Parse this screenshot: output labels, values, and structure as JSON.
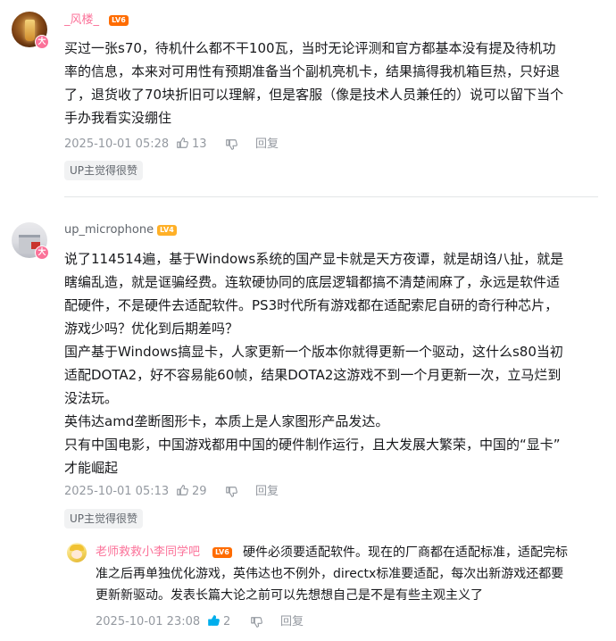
{
  "comments": [
    {
      "username": "_风楼_",
      "level": "LV6",
      "avatar_badge": "大",
      "lines": [
        "买过一张s70，待机什么都不干100瓦，当时无论评测和官方都基本没有提及待机功",
        "率的信息，本来对可用性有预期准备当个副机亮机卡，结果搞得我机箱巨热，只好退",
        "了，退货收了70块折旧可以理解，但是客服（像是技术人员兼任的）说可以留下当个",
        "手办我看实没绷住"
      ],
      "time": "2025-10-01 05:28",
      "likes": "13",
      "reply_label": "回复",
      "tag": "UP主觉得很赞"
    },
    {
      "username": "up_microphone",
      "level": "LV4",
      "avatar_badge": "大",
      "lines": [
        "说了114514遍，基于Windows系统的国产显卡就是天方夜谭，就是胡诌八扯，就是",
        "瞎编乱造，就是诓骗经费。连软硬协同的底层逻辑都搞不清楚闹麻了，永远是软件适",
        "配硬件，不是硬件去适配软件。PS3时代所有游戏都在适配索尼自研的奇行种芯片，",
        "游戏少吗？优化到后期差吗？",
        "国产基于Windows搞显卡，人家更新一个版本你就得更新一个驱动，这什么s80当初",
        "适配DOTA2，好不容易能60帧，结果DOTA2这游戏不到一个月更新一次，立马烂到",
        "没法玩。",
        "英伟达amd垄断图形卡，本质上是人家图形产品发达。",
        "只有中国电影，中国游戏都用中国的硬件制作运行，且大发展大繁荣，中国的“显卡”",
        "才能崛起"
      ],
      "time": "2025-10-01 05:13",
      "likes": "29",
      "reply_label": "回复",
      "tag": "UP主觉得很赞"
    }
  ],
  "sub_reply": {
    "username": "老师救救小李同学吧",
    "level": "LV6",
    "lines": [
      "硬件必须要适配软件。现在的厂商都在适配标准，适配完标",
      "准之后再单独优化游戏，英伟达也不例外，directx标准要适配，每次出新游戏还都要",
      "更新新驱动。发表长篇大论之前可以先想想自己是不是有些主观主义了"
    ],
    "time": "2025-10-01 23:08",
    "likes": "2",
    "reply_label": "回复"
  },
  "colors": {
    "vip_name": "#fb7299",
    "normal_name": "#61666d",
    "lv6": "#ff6c00",
    "lv4": "#ffb027",
    "meta": "#9499a0",
    "liked": "#00aeec"
  },
  "icons": {
    "like": "thumbs-up-icon",
    "dislike": "thumbs-down-icon"
  }
}
